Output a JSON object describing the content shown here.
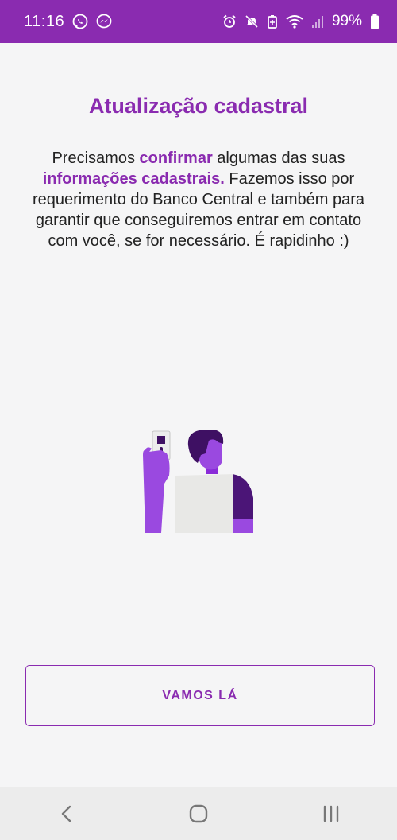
{
  "status_bar": {
    "time": "11:16",
    "battery": "99%",
    "icons_left": [
      "whatsapp-icon",
      "messenger-icon"
    ],
    "icons_right": [
      "alarm-icon",
      "mute-icon",
      "battery-saver-icon",
      "wifi-icon",
      "signal-icon",
      "battery-icon"
    ],
    "background": "#8a2bb0"
  },
  "page": {
    "title": "Atualização cadastral",
    "desc_1": "Precisamos ",
    "desc_hl_1": "confirmar",
    "desc_2": " algumas das suas ",
    "desc_hl_2": "informações cadastrais.",
    "desc_3": " Fazemos isso por requerimento do Banco Central e também para garantir que conseguiremos entrar em contato com você, se for necessário. É rapidinho :)",
    "accent": "#8a2bb0"
  },
  "illustration": {
    "icon": "person-holding-id-card"
  },
  "cta": {
    "label": "VAMOS LÁ"
  },
  "nav": {
    "icons": [
      "back-icon",
      "home-icon",
      "recents-icon"
    ]
  }
}
